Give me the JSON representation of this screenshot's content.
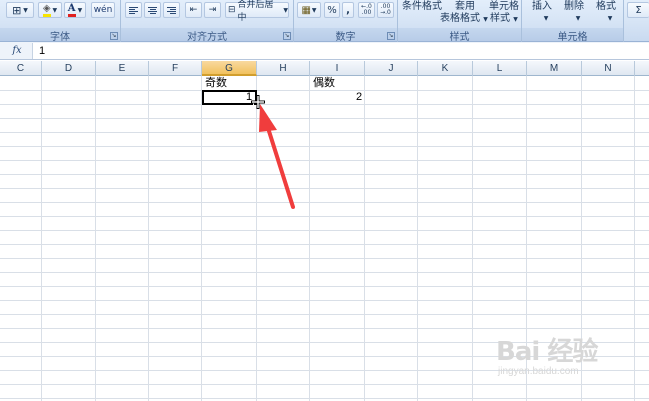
{
  "ribbon": {
    "groups": {
      "font": {
        "label": "字体"
      },
      "alignment": {
        "label": "对齐方式",
        "merge_center": "合并后居中"
      },
      "number": {
        "label": "数字",
        "percent": "%",
        "comma": ",",
        "inc_decimal": ".0 .00",
        "dec_decimal": ".00 .0"
      },
      "styles": {
        "label": "样式",
        "conditional": "条件格式",
        "table_format": "套用\n表格格式",
        "table_format_line1": "套用",
        "table_format_line2": "表格格式",
        "cell_style_line1": "单元格",
        "cell_style_line2": "样式"
      },
      "cells": {
        "label": "单元格",
        "insert": "插入",
        "delete": "删除",
        "format": "格式"
      }
    },
    "font_color_letter": "A",
    "phonetic": "wén"
  },
  "formula_bar": {
    "fx_label": "fx",
    "value": "1"
  },
  "columns": [
    "C",
    "D",
    "E",
    "F",
    "G",
    "H",
    "I",
    "J",
    "K",
    "L",
    "M",
    "N"
  ],
  "active_column": "G",
  "cells": {
    "G1": "奇数",
    "I1": "偶数",
    "G2": "1",
    "I2": "2"
  },
  "colors": {
    "arrow": "#f03d3d",
    "selection_border": "#000000",
    "active_header": "#f1c15f"
  },
  "watermark": {
    "logo": "Bai 经验",
    "url": "jingyan.baidu.com"
  }
}
